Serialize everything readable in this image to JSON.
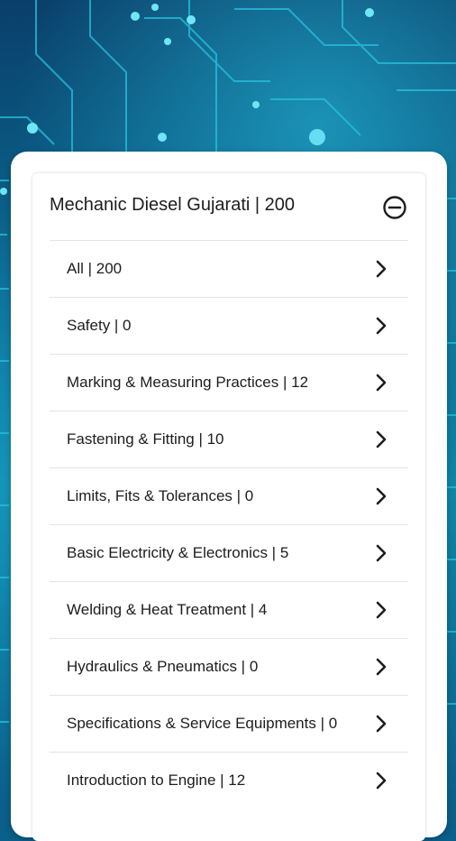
{
  "panel": {
    "title": "Mechanic Diesel Gujarati | 200",
    "collapse_icon": "minus-circle-icon"
  },
  "categories": [
    {
      "label": "All | 200"
    },
    {
      "label": "Safety | 0"
    },
    {
      "label": "Marking & Measuring Practices | 12"
    },
    {
      "label": "Fastening & Fitting | 10"
    },
    {
      "label": "Limits, Fits & Tolerances | 0"
    },
    {
      "label": "Basic Electricity & Electronics | 5"
    },
    {
      "label": "Welding & Heat Treatment | 4"
    },
    {
      "label": "Hydraulics & Pneumatics | 0"
    },
    {
      "label": "Specifications & Service Equipments | 0"
    },
    {
      "label": "Introduction to Engine | 12"
    }
  ],
  "icons": {
    "row_icon": "chevron-right-icon"
  },
  "colors": {
    "background": "#0b5f8a",
    "circuit": "#22c6e6",
    "card": "#ffffff",
    "text": "#1d1d1d"
  }
}
